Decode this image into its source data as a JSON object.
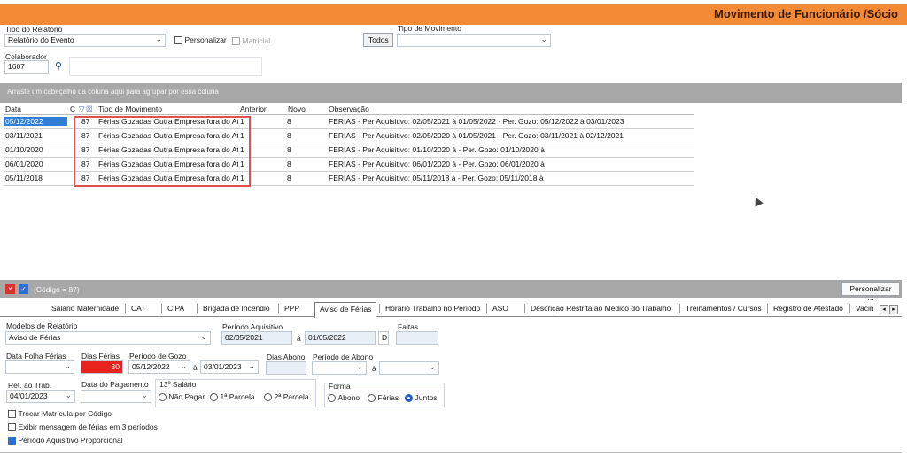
{
  "title": "Movimento de Funcionário /Sócio",
  "top": {
    "tipo_relatorio_label": "Tipo do Relatório",
    "tipo_relatorio_value": "Relatório do Evento",
    "personalizar_label": "Personalizar",
    "matricial_label": "Matricial",
    "todos_label": "Todos",
    "tipo_movimento_label": "Tipo de Movimento",
    "tipo_movimento_value": "",
    "colaborador_label": "Colaborador",
    "colaborador_value": "1607"
  },
  "group_hint": "Arraste um cabeçalho da coluna aqui para agrupar por essa coluna",
  "grid": {
    "headers": {
      "data": "Data",
      "c": "C",
      "tipo": "Tipo de Movimento",
      "anterior": "Anterior",
      "novo": "Novo",
      "obs": "Observação"
    },
    "rows": [
      {
        "data": "05/12/2022",
        "code": "87",
        "tipo": "Férias Gozadas Outra Empresa fora do Atl",
        "anterior": "1",
        "novo": "8",
        "obs": "FERIAS - Per Aquisitivo: 02/05/2021 à 01/05/2022 - Per. Gozo: 05/12/2022 à 03/01/2023"
      },
      {
        "data": "03/11/2021",
        "code": "87",
        "tipo": "Férias Gozadas Outra Empresa fora do Atl",
        "anterior": "1",
        "novo": "8",
        "obs": "FERIAS - Per Aquisitivo: 02/05/2020 à 01/05/2021 - Per. Gozo: 03/11/2021 à 02/12/2021"
      },
      {
        "data": "01/10/2020",
        "code": "87",
        "tipo": "Férias Gozadas Outra Empresa fora do Atl",
        "anterior": "1",
        "novo": "8",
        "obs": "FERIAS - Per Aquisitivo: 01/10/2020 à  - Per. Gozo: 01/10/2020 à"
      },
      {
        "data": "06/01/2020",
        "code": "87",
        "tipo": "Férias Gozadas Outra Empresa fora do Atl",
        "anterior": "1",
        "novo": "8",
        "obs": "FERIAS - Per Aquisitivo: 06/01/2020 à  - Per. Gozo: 06/01/2020 à"
      },
      {
        "data": "05/11/2018",
        "code": "87",
        "tipo": "Férias Gozadas Outra Empresa fora do Atl",
        "anterior": "1",
        "novo": "8",
        "obs": "FERIAS - Per Aquisitivo: 05/11/2018 à  - Per. Gozo: 05/11/2018 à"
      }
    ]
  },
  "filter_text": "(Código = 87)",
  "personalizar_button": "Personalizar ...",
  "tabs": [
    "Salário Maternidade",
    "CAT",
    "CIPA",
    "Brigada de Incêndio",
    "PPP",
    "Aviso de Férias",
    "Horário Trabalho no Período",
    "ASO",
    "Descrição Restrita ao Médico do Trabalho",
    "Treinamentos / Cursos",
    "Registro de Atestado",
    "Vacin"
  ],
  "form": {
    "modelos_label": "Modelos de Relatório",
    "modelos_value": "Aviso de Férias",
    "periodo_aquisitivo_label": "Período Aquisitivo",
    "pa_inicio": "02/05/2021",
    "pa_sep": "à",
    "pa_fim": "01/05/2022",
    "pa_d": "D",
    "faltas_label": "Faltas",
    "data_folha_label": "Data Folha Férias",
    "dias_ferias_label": "Dias Férias",
    "dias_ferias_value": "30",
    "periodo_gozo_label": "Período de Gozo",
    "pg_inicio": "05/12/2022",
    "pg_sep": "à",
    "pg_fim": "03/01/2023",
    "dias_abono_label": "Dias Abono",
    "periodo_abono_label": "Período de Abono",
    "abono_sep": "à",
    "ret_trab_label": "Ret. ao Trab.",
    "ret_trab_value": "04/01/2023",
    "data_pagamento_label": "Data do Pagamento",
    "decimo_label": "13º Salário",
    "decimo_options": [
      "Não Pagar",
      "1ª Parcela",
      "2ª Parcela"
    ],
    "forma_label": "Forma",
    "forma_options": [
      "Abono",
      "Férias",
      "Juntos"
    ],
    "trocar_matricula": "Trocar Matrícula por Código",
    "exibir_mensagem": "Exibir mensagem de férias em 3 períodos",
    "periodo_proporcional": "Período Aquisitivo Proporcional"
  }
}
